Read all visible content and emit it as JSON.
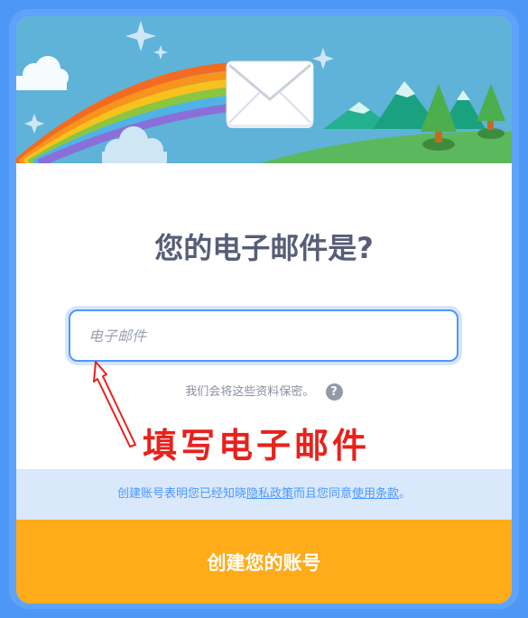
{
  "dialog": {
    "title": "您的电子邮件是?",
    "email_placeholder": "电子邮件",
    "email_value": "",
    "privacy_note": "我们会将这些资料保密。",
    "help_symbol": "?",
    "terms": {
      "prefix": "创建账号表明您已经知晓",
      "privacy_link": "隐私政策",
      "middle": "而且您同意",
      "terms_link": "使用条款",
      "suffix": "。"
    },
    "create_button": "创建您的账号"
  },
  "annotation": {
    "text": "填写电子邮件",
    "color": "#e8211c"
  },
  "colors": {
    "brand_blue": "#4c97ff",
    "button_orange": "#ffab1a",
    "title_gray": "#575e75"
  },
  "icons": [
    "envelope-icon",
    "rainbow-illustration",
    "help-icon",
    "red-arrow-icon"
  ]
}
